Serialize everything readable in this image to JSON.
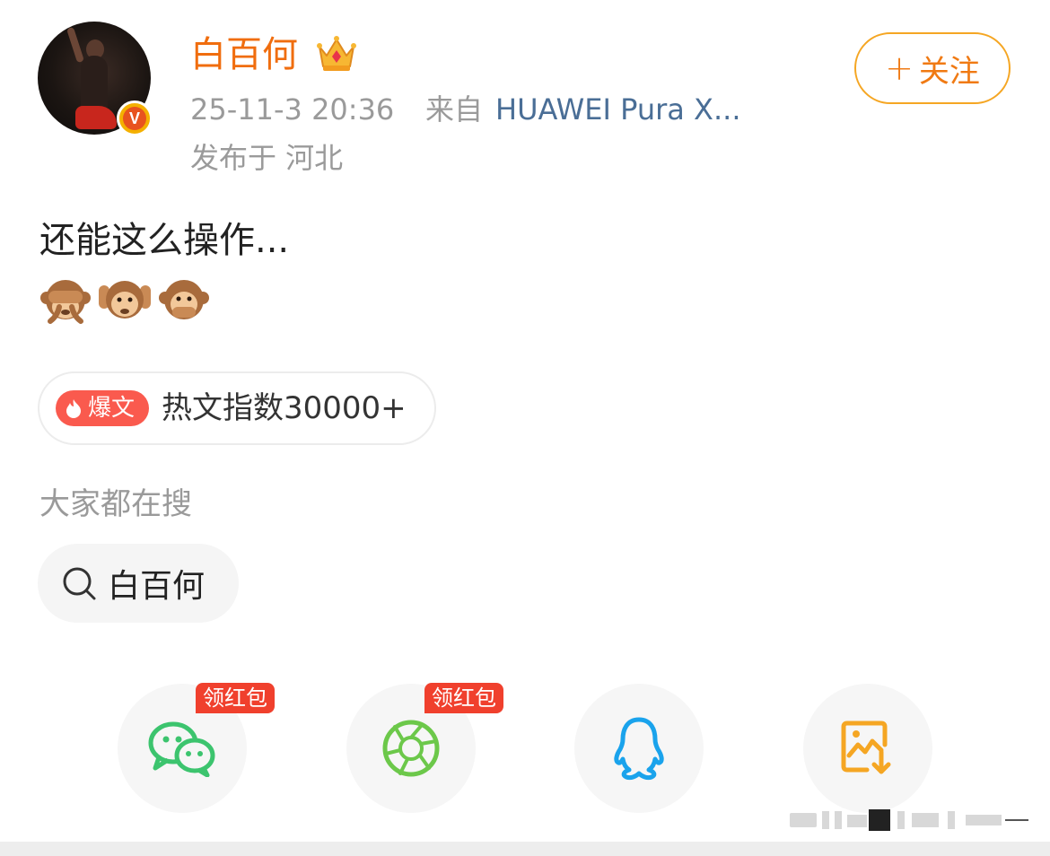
{
  "header": {
    "username": "白百何",
    "time": "25-11-3 20:36",
    "from_label": "来自",
    "device": "HUAWEI Pura X...",
    "location": "发布于 河北",
    "follow_plus": "+",
    "follow_label": "关注"
  },
  "post": {
    "text": "还能这么操作...",
    "emojis": [
      "see-no-evil-monkey",
      "hear-no-evil-monkey",
      "speak-no-evil-monkey"
    ]
  },
  "hot": {
    "tag": "爆文",
    "index_text": "热文指数30000+"
  },
  "search": {
    "heading": "大家都在搜",
    "chip": "白百何"
  },
  "share": {
    "items": [
      {
        "name": "wechat",
        "badge": "领红包",
        "icon": "wechat-icon",
        "color": "#3cc46e"
      },
      {
        "name": "moments",
        "badge": "领红包",
        "icon": "moments-icon",
        "color": "#6cc84a"
      },
      {
        "name": "qq",
        "badge": "",
        "icon": "qq-icon",
        "color": "#1aa3ec"
      },
      {
        "name": "save-image",
        "badge": "",
        "icon": "save-image-icon",
        "color": "#f5a623"
      }
    ]
  },
  "colors": {
    "accent_orange": "#f06d0e",
    "link_blue": "#4a6e96",
    "hot_red": "#fa5a4e",
    "muted_gray": "#9a9a9a"
  }
}
